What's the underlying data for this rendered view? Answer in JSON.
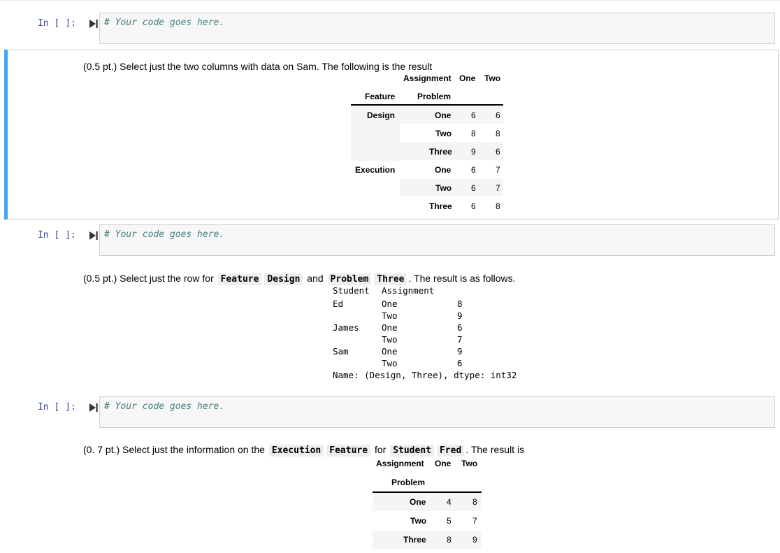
{
  "prompt_label": "In [ ]:",
  "code_placeholder": "# Your code goes here.",
  "cells": {
    "task1": {
      "text": "(0.5 pt.) Select just the two columns with data on Sam. The following is the result"
    },
    "task2": {
      "text_before": "(0.5 pt.) Select just the row for",
      "code1": "Feature",
      "code2": "Design",
      "text_mid": "and",
      "code3": "Problem",
      "code4": "Three",
      "text_after": ". The result is as follows."
    },
    "task3": {
      "text_before": "(0. 7 pt.) Select just the information on the",
      "code1": "Execution",
      "code2": "Feature",
      "text_mid": "for",
      "code3": "Student",
      "code4": "Fred",
      "text_after": ". The result is"
    }
  },
  "table1": {
    "col_index_name": "Assignment",
    "columns": [
      "One",
      "Two"
    ],
    "row_index_names": [
      "Feature",
      "Problem"
    ],
    "rows": [
      {
        "feature": "Design",
        "problem": "One",
        "values": [
          "6",
          "6"
        ]
      },
      {
        "feature": "",
        "problem": "Two",
        "values": [
          "8",
          "8"
        ]
      },
      {
        "feature": "",
        "problem": "Three",
        "values": [
          "9",
          "6"
        ]
      },
      {
        "feature": "Execution",
        "problem": "One",
        "values": [
          "6",
          "7"
        ]
      },
      {
        "feature": "",
        "problem": "Two",
        "values": [
          "6",
          "7"
        ]
      },
      {
        "feature": "",
        "problem": "Three",
        "values": [
          "6",
          "8"
        ]
      }
    ]
  },
  "series": {
    "header_student": "Student",
    "header_assignment": "Assignment",
    "rows": [
      {
        "student": "Ed",
        "assignment": "One",
        "value": "8"
      },
      {
        "student": "",
        "assignment": "Two",
        "value": "9"
      },
      {
        "student": "James",
        "assignment": "One",
        "value": "6"
      },
      {
        "student": "",
        "assignment": "Two",
        "value": "7"
      },
      {
        "student": "Sam",
        "assignment": "One",
        "value": "9"
      },
      {
        "student": "",
        "assignment": "Two",
        "value": "6"
      }
    ],
    "footer": "Name: (Design, Three), dtype: int32"
  },
  "table2": {
    "col_index_name": "Assignment",
    "columns": [
      "One",
      "Two"
    ],
    "row_index_name": "Problem",
    "rows": [
      {
        "problem": "One",
        "values": [
          "4",
          "8"
        ]
      },
      {
        "problem": "Two",
        "values": [
          "5",
          "7"
        ]
      },
      {
        "problem": "Three",
        "values": [
          "8",
          "9"
        ]
      }
    ]
  }
}
